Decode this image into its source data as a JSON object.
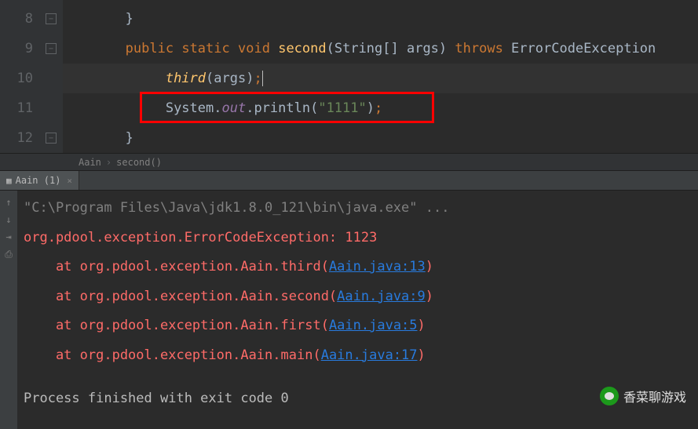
{
  "editor": {
    "lines": [
      {
        "num": "8",
        "fold": "−"
      },
      {
        "num": "9",
        "fold": "−"
      },
      {
        "num": "10",
        "fold": ""
      },
      {
        "num": "11",
        "fold": ""
      },
      {
        "num": "12",
        "fold": "−"
      }
    ],
    "l8_brace": "}",
    "l9_public": "public",
    "l9_static": "static",
    "l9_void": "void",
    "l9_second": "second",
    "l9_args": "(String[] args) ",
    "l9_throws": "throws",
    "l9_exc": " ErrorCodeException",
    "l10_third": "third",
    "l10_args": "(args)",
    "l10_semi": ";",
    "l11_system": "System.",
    "l11_out": "out",
    "l11_println": ".println(",
    "l11_str": "\"1111\"",
    "l11_close": ")",
    "l11_semi": ";",
    "l12_brace": "}"
  },
  "breadcrumb": {
    "item1": "Aain",
    "item2": "second()"
  },
  "tab": {
    "label": "Aain (1)",
    "close": "×"
  },
  "console": {
    "cmd": "\"C:\\Program Files\\Java\\jdk1.8.0_121\\bin\\java.exe\" ...",
    "exception": "org.pdool.exception.ErrorCodeException: 1123",
    "trace": [
      {
        "prefix": "    at org.pdool.exception.Aain.third(",
        "link": "Aain.java:13",
        "suffix": ")"
      },
      {
        "prefix": "    at org.pdool.exception.Aain.second(",
        "link": "Aain.java:9",
        "suffix": ")"
      },
      {
        "prefix": "    at org.pdool.exception.Aain.first(",
        "link": "Aain.java:5",
        "suffix": ")"
      },
      {
        "prefix": "    at org.pdool.exception.Aain.main(",
        "link": "Aain.java:17",
        "suffix": ")"
      }
    ],
    "exit": "Process finished with exit code 0"
  },
  "watermark": "香菜聊游戏"
}
